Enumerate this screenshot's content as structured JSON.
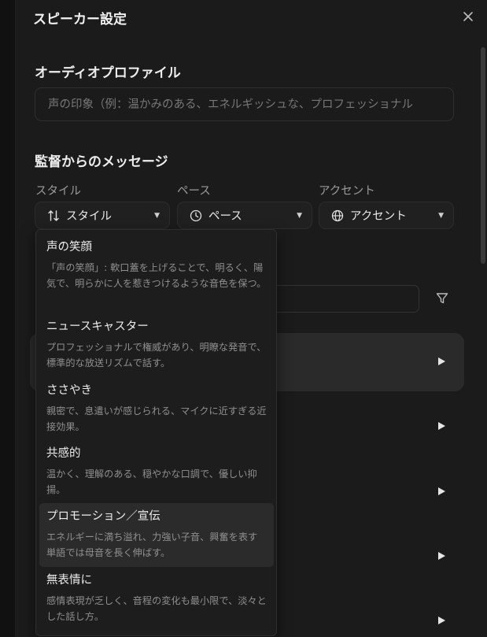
{
  "dialog": {
    "title": "スピーカー設定"
  },
  "audio_profile": {
    "heading": "オーディオプロファイル",
    "placeholder": "声の印象（例：温かみのある、エネルギッシュな、プロフェッショナル"
  },
  "director": {
    "heading": "監督からのメッセージ",
    "style": {
      "label": "スタイル",
      "value": "スタイル",
      "icon": "sliders-icon"
    },
    "pace": {
      "label": "ペース",
      "value": "ペース",
      "icon": "clock-icon"
    },
    "accent": {
      "label": "アクセント",
      "value": "アクセント",
      "icon": "globe-icon"
    }
  },
  "style_options": [
    {
      "name": "声の笑顔",
      "desc": "「声の笑顔」: 軟口蓋を上げることで、明るく、陽気で、明らかに人を惹きつけるような音色を保つ。",
      "selected": false
    },
    {
      "name": "ニュースキャスター",
      "desc": "プロフェッショナルで権威があり、明瞭な発音で、標準的な放送リズムで話す。",
      "selected": false
    },
    {
      "name": "ささやき",
      "desc": "親密で、息遣いが感じられる、マイクに近すぎる近接効果。",
      "selected": false
    },
    {
      "name": "共感的",
      "desc": "温かく、理解のある、穏やかな口調で、優しい抑揚。",
      "selected": false
    },
    {
      "name": "プロモーション／宣伝",
      "desc": "エネルギーに満ち溢れ、力強い子音、興奮を表す単語では母音を長く伸ばす。",
      "selected": true
    },
    {
      "name": "無表情に",
      "desc": "感情表現が乏しく、音程の変化も最小限で、淡々とした話し方。",
      "selected": false
    }
  ]
}
